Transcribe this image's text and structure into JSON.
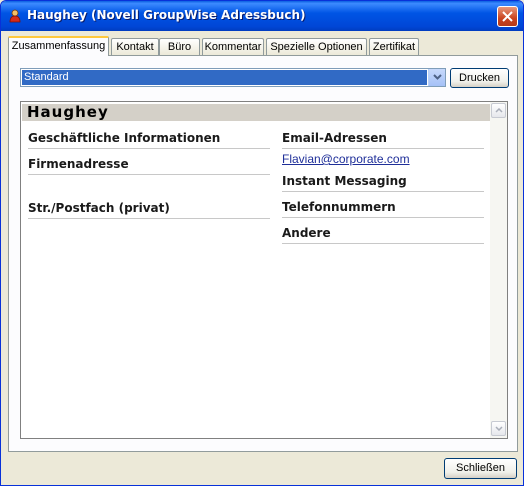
{
  "window": {
    "title": "Haughey (Novell GroupWise Adressbuch)"
  },
  "tabs": [
    {
      "label": "Zusammenfassung",
      "active": true
    },
    {
      "label": "Kontakt"
    },
    {
      "label": "Büro"
    },
    {
      "label": "Kommentar"
    },
    {
      "label": "Spezielle Optionen"
    },
    {
      "label": "Zertifikat"
    }
  ],
  "view_select": {
    "value": "Standard"
  },
  "print_button": "Drucken",
  "contact": {
    "name": "Haughey",
    "left_sections": [
      "Geschäftliche Informationen",
      "Firmenadresse",
      "Str./Postfach (privat)"
    ],
    "right_sections": [
      "Email-Adressen",
      "Instant Messaging",
      "Telefonnummern",
      "Andere"
    ],
    "email": "Flavian@corporate.com"
  },
  "close_button": "Schließen",
  "colors": {
    "titlebar": "#0055e5",
    "selection": "#316ac5",
    "active_tab": "#ffc83c",
    "link": "#1f2f99"
  }
}
